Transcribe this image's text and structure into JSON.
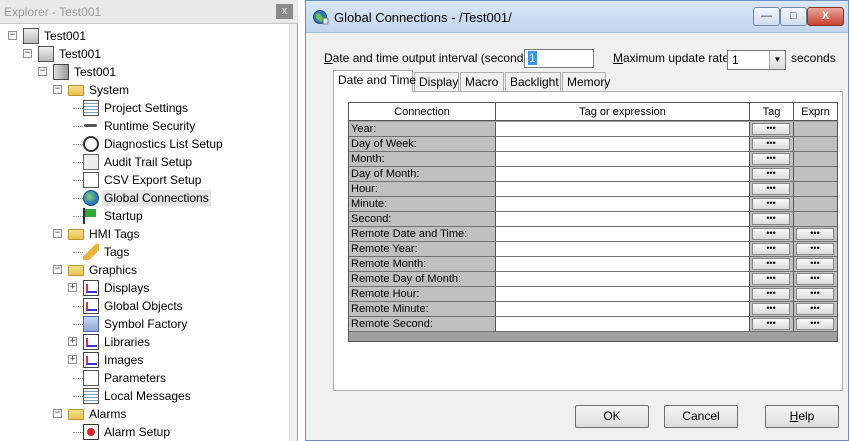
{
  "explorer": {
    "title": "Explorer - Test001",
    "close_label": "x",
    "tree": [
      {
        "label": "Test001",
        "icon": "application-icon",
        "level": 0,
        "expanded": true
      },
      {
        "label": "Test001",
        "icon": "computer-icon",
        "level": 1,
        "expanded": true
      },
      {
        "label": "Test001",
        "icon": "server-icon",
        "level": 2,
        "expanded": true
      },
      {
        "label": "System",
        "icon": "folder-icon",
        "level": 3,
        "expanded": true
      },
      {
        "label": "Project Settings",
        "icon": "settings-doc-icon",
        "level": 4
      },
      {
        "label": "Runtime Security",
        "icon": "key-icon",
        "level": 4
      },
      {
        "label": "Diagnostics List Setup",
        "icon": "clock-icon",
        "level": 4
      },
      {
        "label": "Audit Trail Setup",
        "icon": "stamp-icon",
        "level": 4
      },
      {
        "label": "CSV Export Setup",
        "icon": "document-icon",
        "level": 4
      },
      {
        "label": "Global Connections",
        "icon": "globe-icon",
        "level": 4,
        "selected": true
      },
      {
        "label": "Startup",
        "icon": "flag-icon",
        "level": 4
      },
      {
        "label": "HMI Tags",
        "icon": "folder-icon",
        "level": 3,
        "expanded": true
      },
      {
        "label": "Tags",
        "icon": "pencil-icon",
        "level": 4
      },
      {
        "label": "Graphics",
        "icon": "folder-icon",
        "level": 3,
        "expanded": true
      },
      {
        "label": "Displays",
        "icon": "chart-icon",
        "level": 4,
        "collapsed": true
      },
      {
        "label": "Global Objects",
        "icon": "chart-icon",
        "level": 4
      },
      {
        "label": "Symbol Factory",
        "icon": "tree-icon",
        "level": 4
      },
      {
        "label": "Libraries",
        "icon": "chart-icon",
        "level": 4,
        "collapsed": true
      },
      {
        "label": "Images",
        "icon": "image-icon",
        "level": 4,
        "collapsed": true
      },
      {
        "label": "Parameters",
        "icon": "document-icon",
        "level": 4
      },
      {
        "label": "Local Messages",
        "icon": "settings-doc-icon",
        "level": 4
      },
      {
        "label": "Alarms",
        "icon": "folder-icon",
        "level": 3,
        "expanded": true
      },
      {
        "label": "Alarm Setup",
        "icon": "alarm-icon",
        "level": 4
      }
    ]
  },
  "dialog": {
    "title": "Global Connections - /Test001/",
    "minimize": "—",
    "maximize": "□",
    "close": "X",
    "interval_label_u": "D",
    "interval_label_rest": "ate and time output interval (seconds):",
    "interval_value": "1",
    "rate_label_u": "M",
    "rate_label_rest": "aximum update rate:",
    "rate_value": "1",
    "rate_unit": "seconds",
    "tabs": [
      "Date and Time",
      "Display",
      "Macro",
      "Backlight",
      "Memory"
    ],
    "active_tab": 0,
    "grid": {
      "headers": [
        "Connection",
        "Tag or expression",
        "Tag",
        "Exprn"
      ],
      "dots": "•••",
      "rows": [
        {
          "connection": "Year:",
          "exprn": false
        },
        {
          "connection": "Day of Week:",
          "exprn": false
        },
        {
          "connection": "Month:",
          "exprn": false
        },
        {
          "connection": "Day of Month:",
          "exprn": false
        },
        {
          "connection": "Hour:",
          "exprn": false
        },
        {
          "connection": "Minute:",
          "exprn": false
        },
        {
          "connection": "Second:",
          "exprn": false
        },
        {
          "connection": "Remote Date and Time:",
          "exprn": true
        },
        {
          "connection": "Remote Year:",
          "exprn": true
        },
        {
          "connection": "Remote Month:",
          "exprn": true
        },
        {
          "connection": "Remote Day of Month:",
          "exprn": true
        },
        {
          "connection": "Remote Hour:",
          "exprn": true
        },
        {
          "connection": "Remote Minute:",
          "exprn": true
        },
        {
          "connection": "Remote Second:",
          "exprn": true
        }
      ]
    },
    "buttons": {
      "ok": "OK",
      "cancel": "Cancel",
      "help_u": "H",
      "help_rest": "elp"
    }
  }
}
